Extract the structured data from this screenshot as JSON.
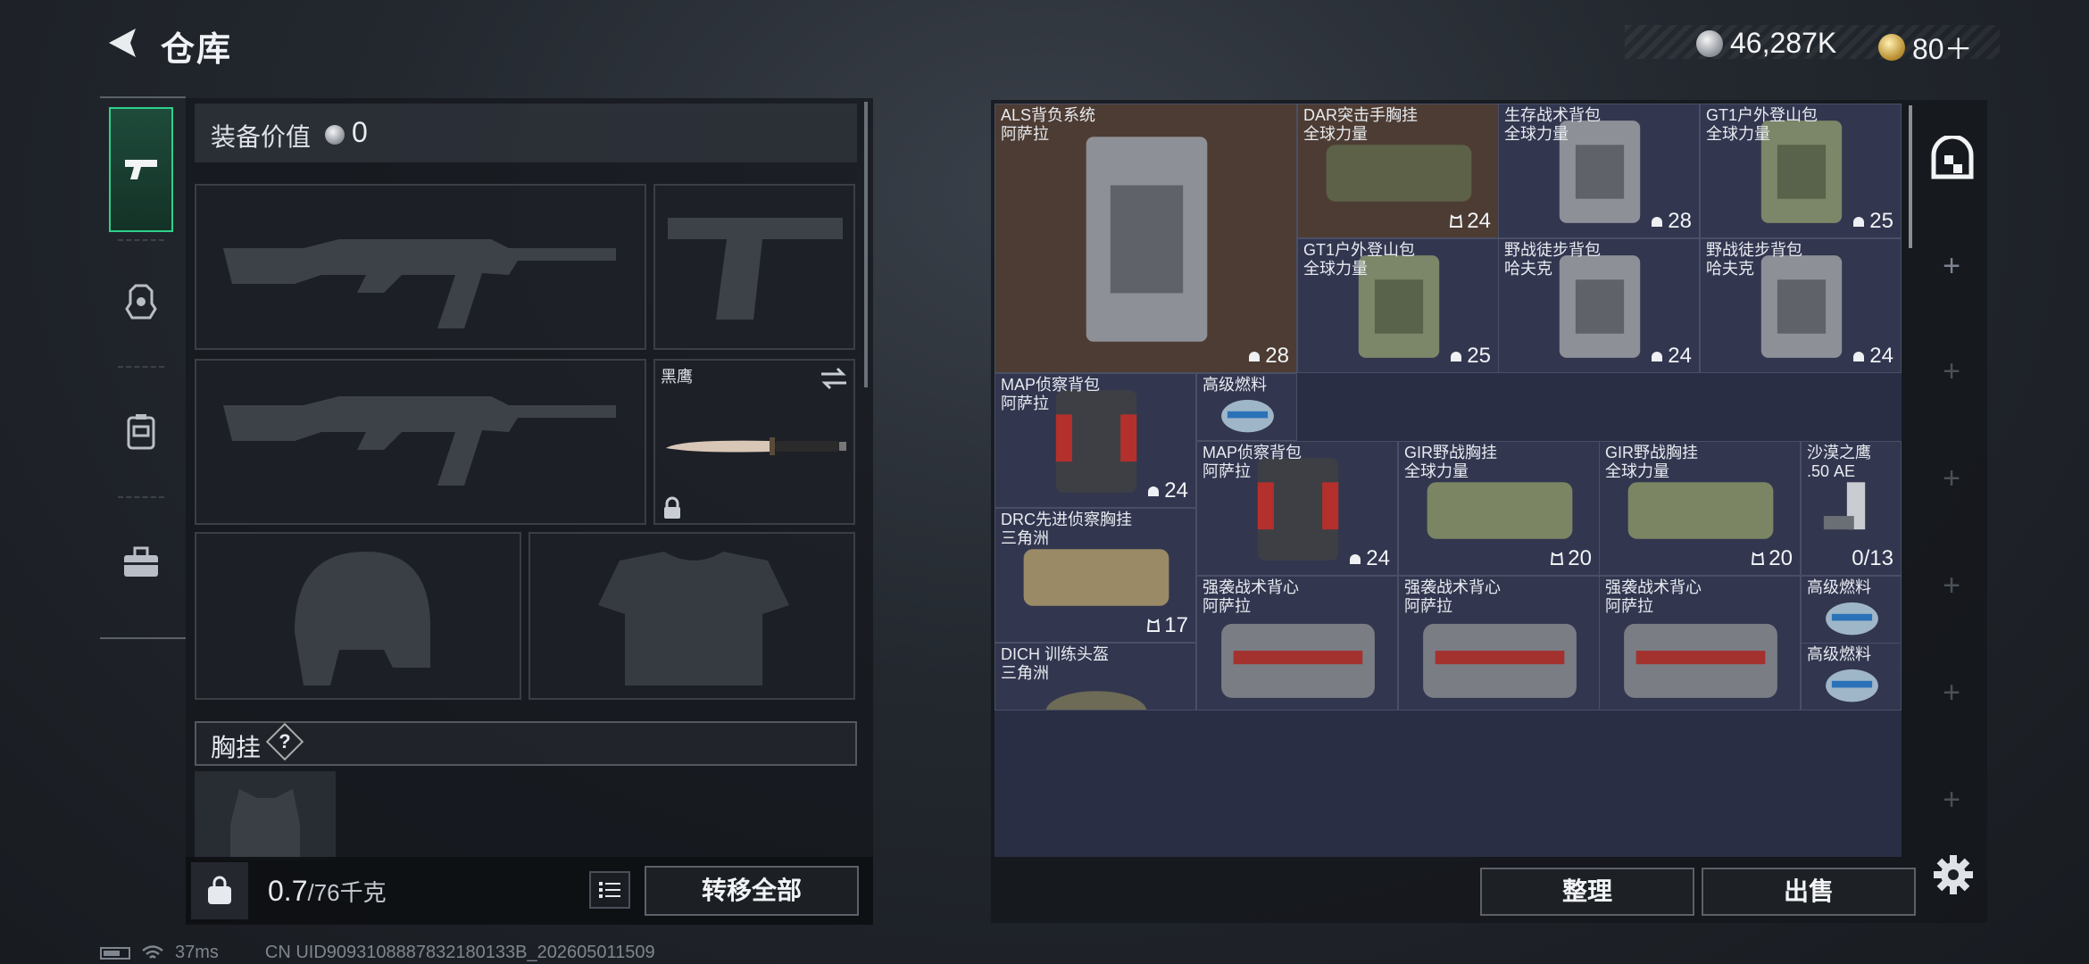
{
  "header": {
    "title": "仓库",
    "currency_silver": "46,287K",
    "currency_gold": "80＋"
  },
  "loadout": {
    "value_label": "装备价值",
    "value": "0",
    "knife_name": "黑鹰",
    "chest_label": "胸挂",
    "help": "?"
  },
  "bottom": {
    "weight_current": "0.7",
    "weight_max": "/76千克",
    "transfer_all": "转移全部",
    "organize": "整理",
    "sell": "出售"
  },
  "storage": {
    "items": [
      {
        "name": "ALS背负系统\n阿萨拉",
        "count": "28"
      },
      {
        "name": "DAR突击手胸挂\n全球力量",
        "count": "24"
      },
      {
        "name": "生存战术背包\n全球力量",
        "count": "28"
      },
      {
        "name": "GT1户外登山包\n全球力量",
        "count": "25"
      },
      {
        "name": "GT1户外登山包\n全球力量",
        "count": "25"
      },
      {
        "name": "野战徒步背包\n哈夫克",
        "count": "24"
      },
      {
        "name": "野战徒步背包\n哈夫克",
        "count": "24"
      },
      {
        "name": "MAP侦察背包\n阿萨拉",
        "count": "24"
      },
      {
        "name": "高级燃料",
        "count": ""
      },
      {
        "name": "MAP侦察背包\n阿萨拉",
        "count": "24"
      },
      {
        "name": "GIR野战胸挂\n全球力量",
        "count": "20"
      },
      {
        "name": "GIR野战胸挂\n全球力量",
        "count": "20"
      },
      {
        "name": "沙漠之鹰\n.50 AE",
        "count": "0/13"
      },
      {
        "name": "DRC先进侦察胸挂\n三角洲",
        "count": "17"
      },
      {
        "name": "强袭战术背心\n阿萨拉",
        "count": ""
      },
      {
        "name": "强袭战术背心\n阿萨拉",
        "count": ""
      },
      {
        "name": "强袭战术背心\n阿萨拉",
        "count": ""
      },
      {
        "name": "高级燃料",
        "count": ""
      },
      {
        "name": "DICH 训练头盔\n三角洲",
        "count": ""
      },
      {
        "name": "高级燃料",
        "count": ""
      }
    ]
  },
  "status": {
    "ping": "37ms",
    "uid": "CN UID9093108887832180133B_202605011509"
  }
}
